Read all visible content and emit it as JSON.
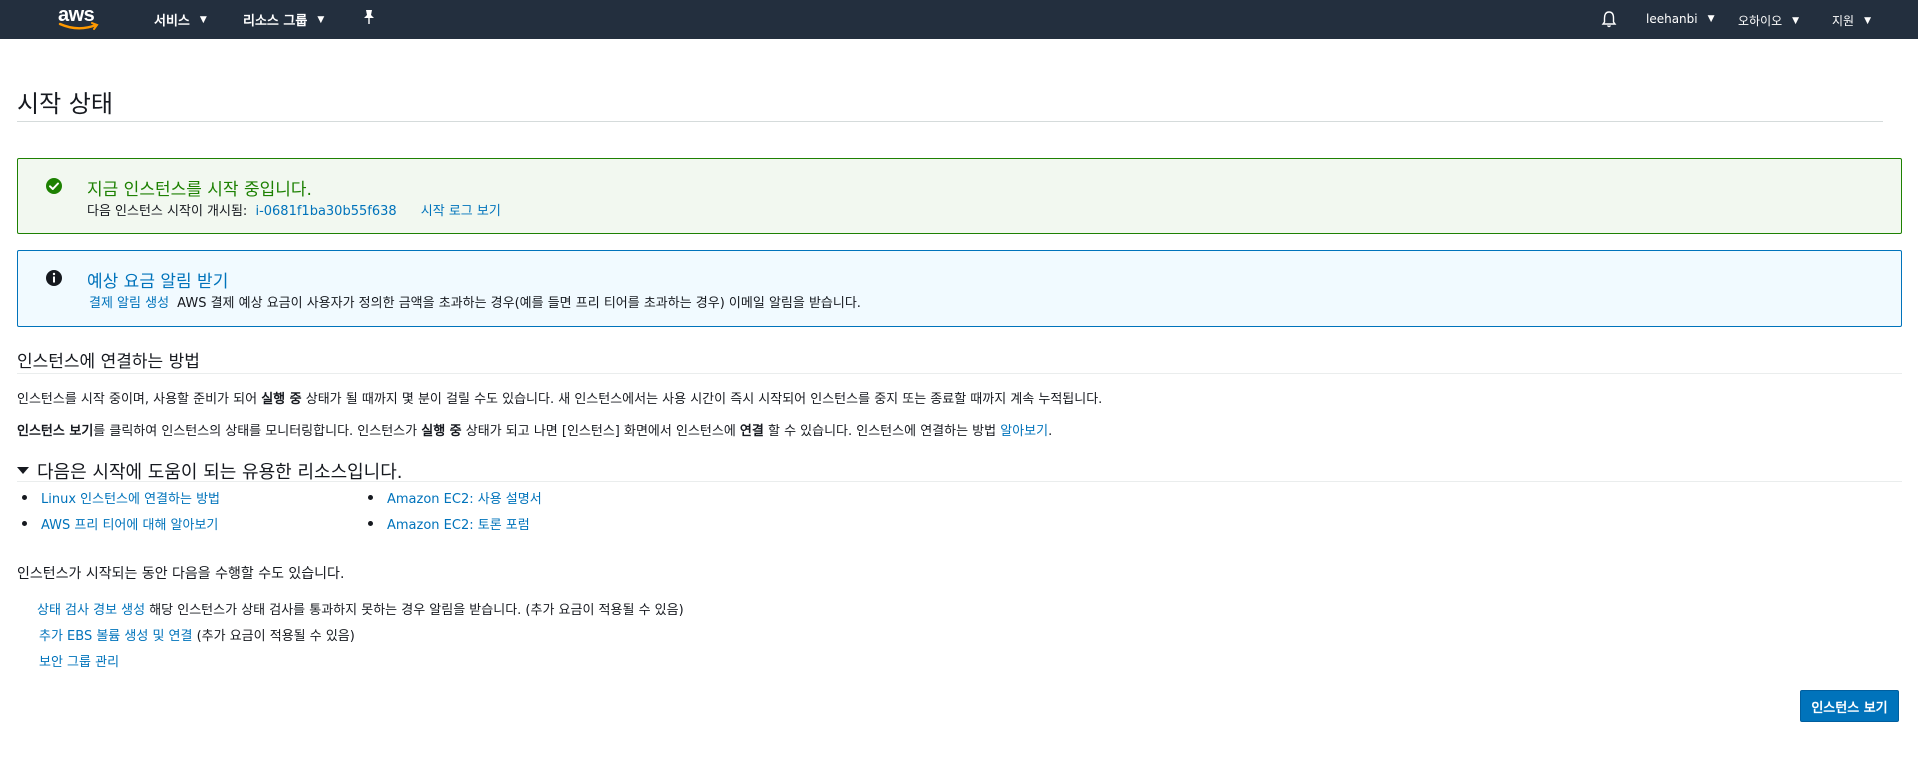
{
  "nav": {
    "logo": "aws",
    "services": "서비스",
    "resource_groups": "리소스 그룹",
    "pin_icon": "pin-icon",
    "bell_icon": "bell-icon",
    "user": "leehanbi",
    "region": "오하이오",
    "support": "지원"
  },
  "page": {
    "title": "시작 상태"
  },
  "success_alert": {
    "title": "지금 인스턴스를 시작 중입니다.",
    "prefix": "다음 인스턴스 시작이 개시됨:",
    "instance_id": "i-0681f1ba30b55f638",
    "log_link": "시작 로그 보기",
    "icon": "check-circle-icon",
    "color": "#1d8102"
  },
  "info_alert": {
    "title": "예상 요금 알림 받기",
    "link": "결제 알림 생성",
    "text": "AWS 결제 예상 요금이 사용자가 정의한 금액을 초과하는 경우(예를 들면 프리 티어를 초과하는 경우) 이메일 알림을 받습니다.",
    "icon": "info-circle-icon",
    "color": "#0073bb"
  },
  "connect": {
    "heading": "인스턴스에 연결하는 방법",
    "p1": {
      "a": "인스턴스를 시작 중이며, 사용할 준비가 되어 ",
      "b": "실행 중",
      "c": " 상태가 될 때까지 몇 분이 걸릴 수도 있습니다. 새 인스턴스에서는 사용 시간이 즉시 시작되어 인스턴스를 중지 또는 종료할 때까지 계속 누적됩니다."
    },
    "p2": {
      "a": "인스턴스 보기",
      "b": "를 클릭하여 인스턴스의 상태를 모니터링합니다. 인스턴스가 ",
      "c": "실행 중",
      "d": " 상태가 되고 나면 [인스턴스] 화면에서 인스턴스에 ",
      "e": "연결",
      "f": " 할 수 있습니다. 인스턴스에 연결하는 방법 ",
      "link": "알아보기",
      "g": "."
    }
  },
  "resources": {
    "heading": "다음은 시작에 도움이 되는 유용한 리소스입니다.",
    "left": [
      "Linux 인스턴스에 연결하는 방법",
      "AWS 프리 티어에 대해 알아보기"
    ],
    "right": [
      "Amazon EC2: 사용 설명서",
      "Amazon EC2: 토론 포럼"
    ]
  },
  "actions": {
    "heading": "인스턴스가 시작되는 동안 다음을 수행할 수도 있습니다.",
    "items": [
      {
        "link": "상태 검사 경보 생성",
        "text": " 해당 인스턴스가 상태 검사를 통과하지 못하는 경우 알림을 받습니다. (추가 요금이 적용될 수 있음)"
      },
      {
        "link": "추가 EBS 볼륨 생성 및 연결",
        "text": " (추가 요금이 적용될 수 있음)"
      },
      {
        "link": "보안 그룹 관리",
        "text": ""
      }
    ]
  },
  "primary_button": "인스턴스 보기"
}
